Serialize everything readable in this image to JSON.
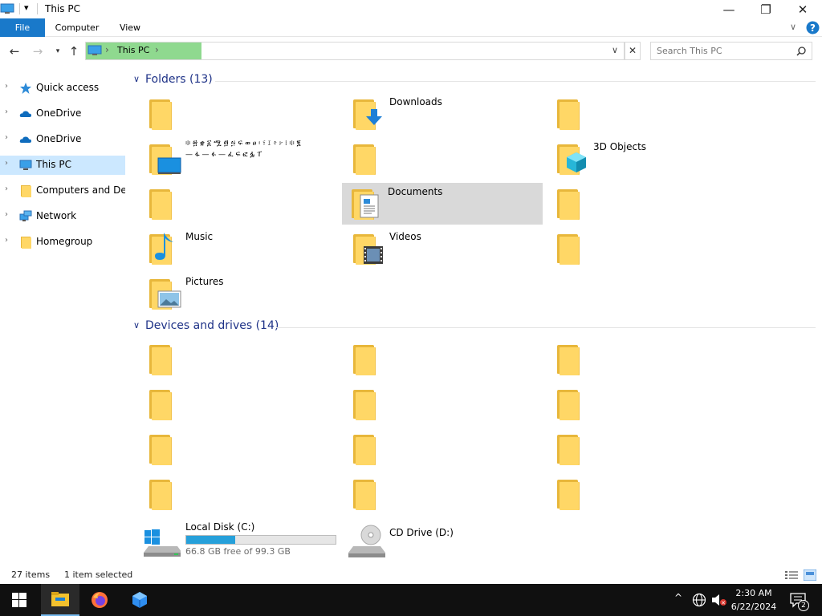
{
  "window": {
    "title": "This PC",
    "minimize": "—",
    "restore": "❐",
    "close": "✕"
  },
  "ribbon": {
    "tabs": [
      "File",
      "Computer",
      "View"
    ]
  },
  "address": {
    "crumb": "This PC",
    "sep": "›"
  },
  "search": {
    "placeholder": "Search This PC"
  },
  "sidebar": {
    "items": [
      {
        "label": "Quick access",
        "icon": "star-icon"
      },
      {
        "label": "OneDrive",
        "icon": "cloud-icon"
      },
      {
        "label": "OneDrive",
        "icon": "cloud-icon"
      },
      {
        "label": "This PC",
        "icon": "computer-icon",
        "selected": true
      },
      {
        "label": "Computers and Devices",
        "icon": "folder-icon"
      },
      {
        "label": "Network",
        "icon": "network-icon"
      },
      {
        "label": "Homegroup",
        "icon": "folder-icon"
      }
    ]
  },
  "folders_group": {
    "label": "Folders (13)"
  },
  "folders": [
    {
      "label": ""
    },
    {
      "label": "Downloads",
      "overlay": "download-arrow"
    },
    {
      "label": ""
    },
    {
      "label": "፨ ፳ ቋ ፩ ሟ ፴ ፵ ፍ ወ ፀ ፡ ፣ ፤ ፥ ፦ ፧ ፨ ፪",
      "label2": "— ፋ — ፉ — ፈ ፍ ፎ ፏ ፐ",
      "overlay": "desktop"
    },
    {
      "label": ""
    },
    {
      "label": "3D Objects",
      "overlay": "cube"
    },
    {
      "label": ""
    },
    {
      "label": "Documents",
      "overlay": "document",
      "selected": true
    },
    {
      "label": ""
    },
    {
      "label": "Music",
      "overlay": "music-note"
    },
    {
      "label": "Videos",
      "overlay": "film"
    },
    {
      "label": ""
    },
    {
      "label": "Pictures",
      "overlay": "picture"
    }
  ],
  "drives_group": {
    "label": "Devices and drives (14)"
  },
  "drives_folders": 12,
  "drives": [
    {
      "label": "Local Disk (C:)",
      "free": "66.8 GB free of 99.3 GB",
      "used_fraction": 0.327,
      "icon": "windows-drive-icon"
    },
    {
      "label": "CD Drive (D:)",
      "icon": "cd-drive-icon"
    }
  ],
  "status": {
    "items": "27 items",
    "selected": "1 item selected"
  },
  "taskbar": {
    "time": "2:30 AM",
    "date": "6/22/2024",
    "notifications": "2"
  },
  "colors": {
    "accent": "#1979ca",
    "selection": "#cce8ff",
    "address_highlight": "#8fd98f",
    "drive_bar": "#26a0da"
  }
}
